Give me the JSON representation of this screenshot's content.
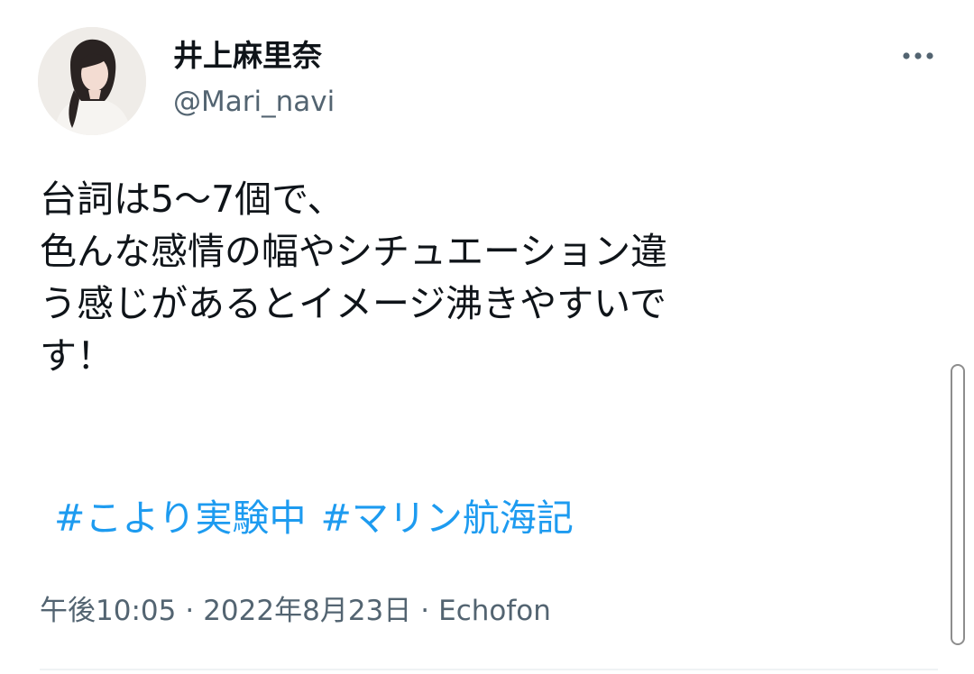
{
  "author": {
    "display_name": "井上麻里奈",
    "handle": "@Mari_navi",
    "avatar_icon": "profile-photo"
  },
  "more_icon": "more-horizontal-icon",
  "tweet": {
    "lines": [
      "台詞は5〜7個で、",
      "色んな感情の幅やシチュエーション違",
      "う感じがあるとイメージ沸きやすいで",
      "す！"
    ],
    "hashtags": [
      "#こより実験中",
      "#マリン航海記"
    ]
  },
  "meta": {
    "time": "午後10:05",
    "date": "2022年8月23日",
    "source": "Echofon",
    "separator": "·"
  },
  "colors": {
    "text": "#0f1419",
    "secondary": "#536471",
    "link": "#1d9bf0"
  }
}
